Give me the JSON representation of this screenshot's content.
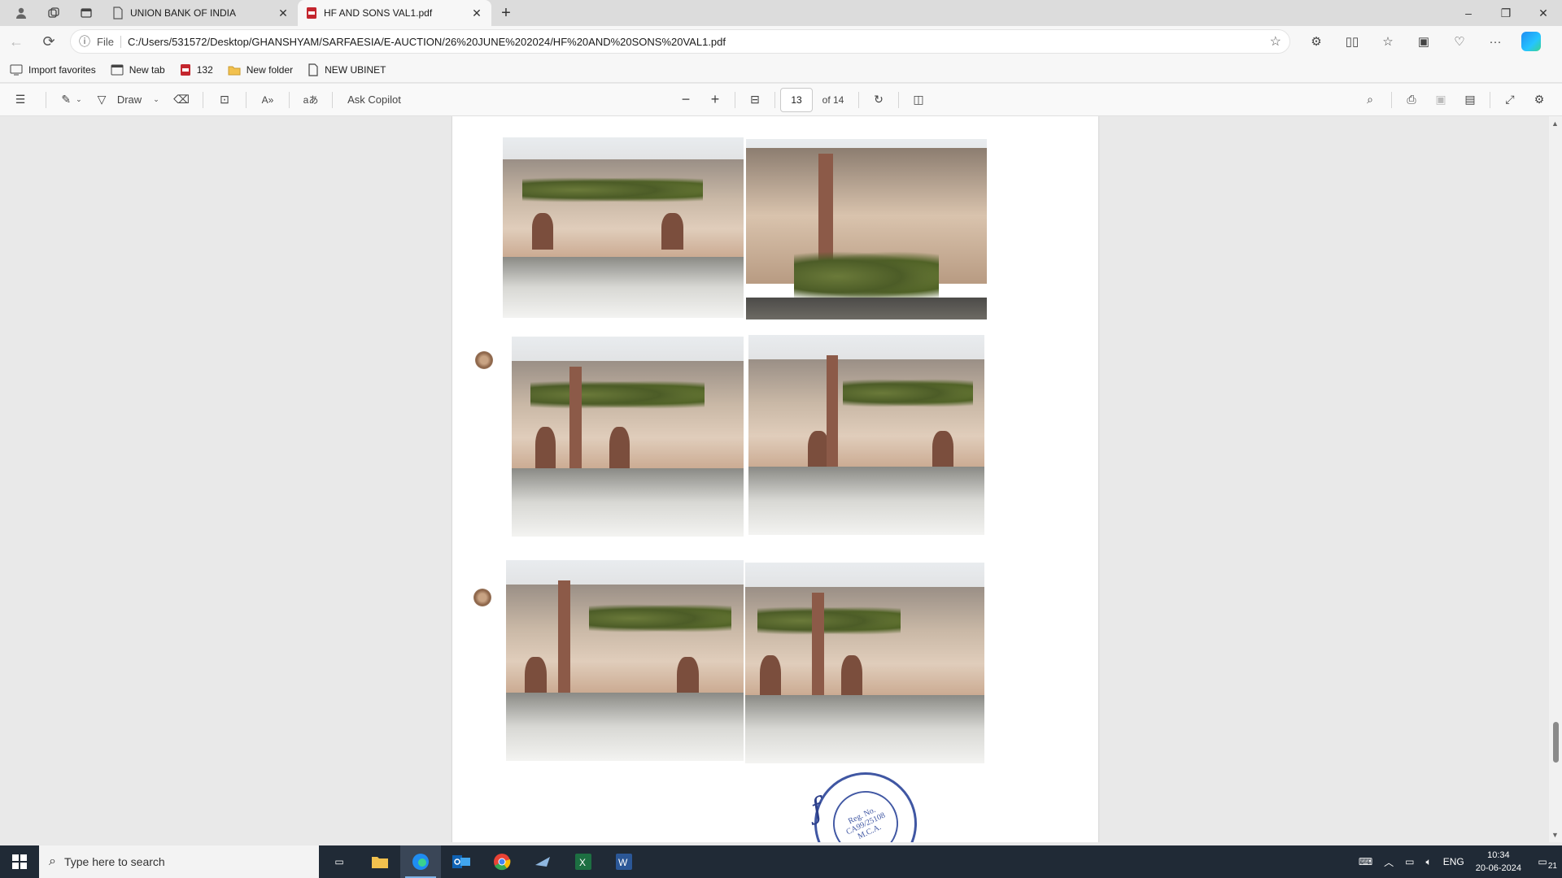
{
  "browser": {
    "tabs": [
      {
        "title": "UNION BANK OF INDIA",
        "active": false
      },
      {
        "title": "HF AND SONS VAL1.pdf",
        "active": true
      }
    ],
    "address": {
      "scheme_label": "File",
      "url": "C:/Users/531572/Desktop/GHANSHYAM/SARFAESIA/E-AUCTION/26%20JUNE%202024/HF%20AND%20SONS%20VAL1.pdf"
    },
    "favorites": [
      {
        "label": "Import favorites",
        "icon": "import-icon"
      },
      {
        "label": "New tab",
        "icon": "newtab-icon"
      },
      {
        "label": "132",
        "icon": "pdf-icon"
      },
      {
        "label": "New folder",
        "icon": "folder-icon"
      },
      {
        "label": "NEW UBINET",
        "icon": "page-icon"
      }
    ]
  },
  "pdf_toolbar": {
    "draw_label": "Draw",
    "ask_copilot_label": "Ask Copilot",
    "current_page": "13",
    "page_total_label": "of 14"
  },
  "document": {
    "stamp": {
      "line1": "Reg. No.",
      "line2": "CA99/25108",
      "line3": "M.C.A."
    }
  },
  "taskbar": {
    "search_placeholder": "Type here to search",
    "lang": "ENG",
    "time": "10:34",
    "date": "20-06-2024",
    "notification_count": "21"
  },
  "colors": {
    "accent": "#0078d4",
    "taskbar_bg": "#202a36",
    "stamp_blue": "#4057a3"
  }
}
